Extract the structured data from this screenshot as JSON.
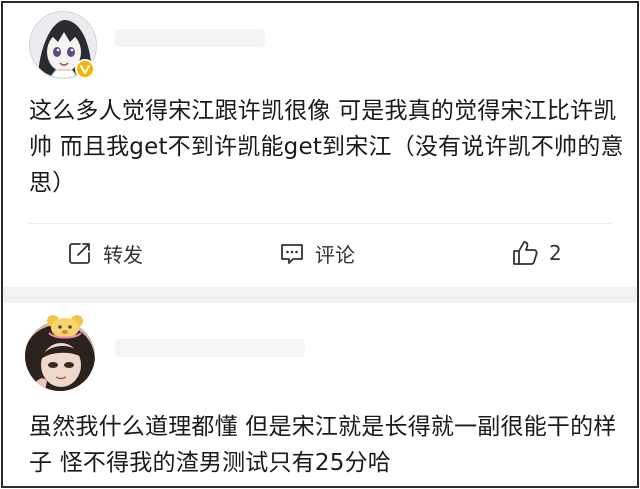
{
  "post1": {
    "avatar": "anime-avatar",
    "badge_color": "#f4b400",
    "text": "这么多人觉得宋江跟许凯很像 可是我真的觉得宋江比许凯帅 而且我get不到许凯能get到宋江（没有说许凯不帅的意思）",
    "actions": {
      "repost_icon": "repost-icon",
      "repost_label": "转发",
      "comment_icon": "comment-icon",
      "comment_label": "评论",
      "like_icon": "thumbs-up-icon",
      "like_count": "2"
    }
  },
  "post2": {
    "avatar": "girl-avatar",
    "text": "虽然我什么道理都懂 但是宋江就是长得就一副很能干的样子 怪不得我的渣男测试只有25分哈"
  }
}
